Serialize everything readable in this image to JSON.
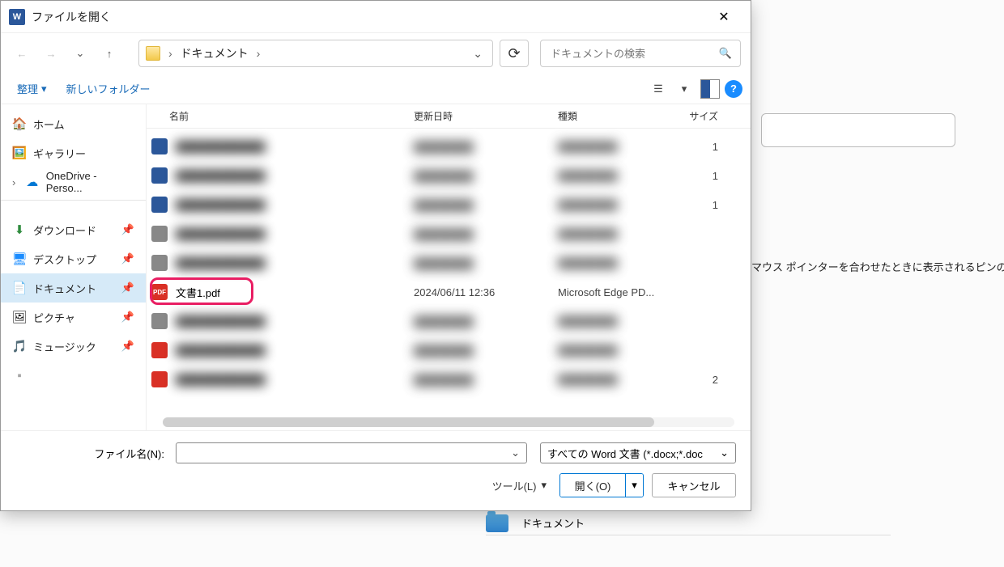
{
  "dialog": {
    "title": "ファイルを開く",
    "breadcrumb": {
      "folder": "ドキュメント"
    },
    "search_placeholder": "ドキュメントの検索",
    "toolbar": {
      "organize": "整理",
      "new_folder": "新しいフォルダー"
    },
    "columns": {
      "name": "名前",
      "date": "更新日時",
      "type": "種類",
      "size": "サイズ"
    }
  },
  "sidebar": {
    "home": "ホーム",
    "gallery": "ギャラリー",
    "onedrive": "OneDrive - Perso...",
    "downloads": "ダウンロード",
    "desktop": "デスクトップ",
    "documents": "ドキュメント",
    "pictures": "ピクチャ",
    "music": "ミュージック"
  },
  "files": {
    "highlighted": {
      "name": "文書1.pdf",
      "date": "2024/06/11 12:36",
      "type": "Microsoft Edge PD...",
      "size": ""
    },
    "blurred_sizes": [
      "1",
      "1",
      "1",
      "",
      "",
      "",
      "",
      "2",
      ""
    ]
  },
  "footer": {
    "filename_label": "ファイル名(N):",
    "filetype": "すべての Word 文書 (*.docx;*.doc",
    "tools": "ツール(L)",
    "open": "開く(O)",
    "cancel": "キャンセル"
  },
  "background": {
    "hint_text": "マウス ポインターを合わせたときに表示されるピンのアイ",
    "folder_label": "ドキュメント"
  }
}
